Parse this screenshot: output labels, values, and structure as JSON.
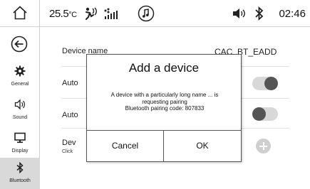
{
  "status_bar": {
    "temperature": "25.5",
    "temperature_unit": "°C",
    "time": "02:46",
    "icons": [
      "home-icon",
      "fan-icon",
      "signal-icon",
      "music-note-icon",
      "volume-icon",
      "bluetooth-icon"
    ]
  },
  "sidebar": {
    "items": [
      {
        "label": "General",
        "icon": "gear-icon"
      },
      {
        "label": "Sound",
        "icon": "speaker-icon"
      },
      {
        "label": "Display",
        "icon": "monitor-icon"
      },
      {
        "label": "Bluetooth",
        "icon": "bluetooth-icon",
        "active": true
      }
    ]
  },
  "settings": {
    "device_name_label": "Device name",
    "device_name_value": "CAC_BT_EADD",
    "auto1_label": "Auto",
    "auto1_state": "on",
    "auto2_label": "Auto",
    "auto2_state": "off",
    "devices_label": "Dev",
    "devices_sub": "Click"
  },
  "dialog": {
    "title": "Add a device",
    "message_line1": "A device with a particularly long name ... is",
    "message_line2": "requesting pairing",
    "message_line3": "Bluetooth pairing code: 807833",
    "cancel_label": "Cancel",
    "ok_label": "OK"
  },
  "colors": {
    "toggle_knob": "#555555",
    "toggle_track": "#d8d8d8",
    "active_sidebar": "#d9d9d9"
  }
}
